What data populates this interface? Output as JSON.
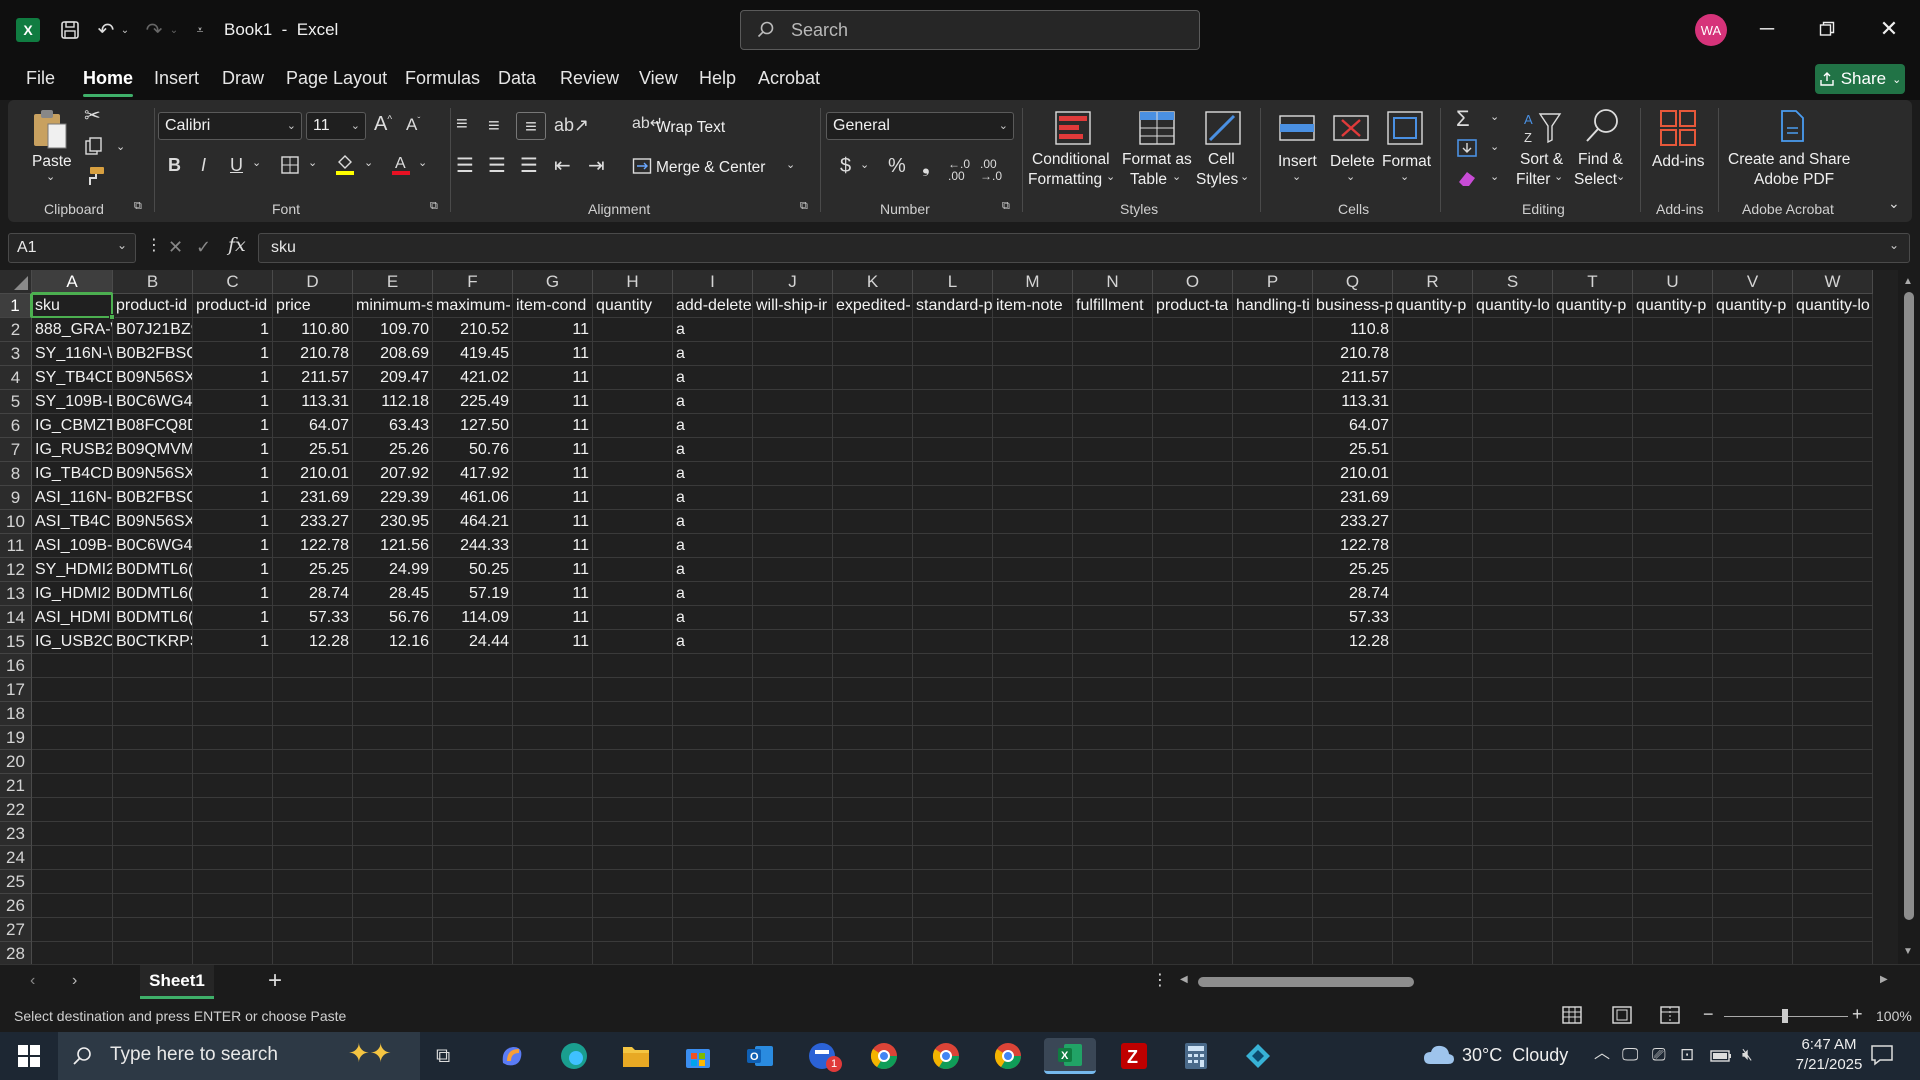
{
  "titlebar": {
    "title": "Book1  -  Excel",
    "search_placeholder": "Search",
    "avatar_initials": "WA"
  },
  "menu": {
    "tabs": [
      "File",
      "Home",
      "Insert",
      "Draw",
      "Page Layout",
      "Formulas",
      "Data",
      "Review",
      "View",
      "Help",
      "Acrobat"
    ],
    "share_label": "Share"
  },
  "ribbon": {
    "clipboard": {
      "paste": "Paste",
      "group": "Clipboard"
    },
    "font": {
      "name": "Calibri",
      "size": "11",
      "group": "Font"
    },
    "alignment": {
      "wrap": "Wrap Text",
      "merge": "Merge & Center",
      "group": "Alignment"
    },
    "number": {
      "format": "General",
      "group": "Number"
    },
    "styles": {
      "conditional_1": "Conditional",
      "conditional_2": "Formatting",
      "table_1": "Format as",
      "table_2": "Table",
      "cell_1": "Cell",
      "cell_2": "Styles",
      "group": "Styles"
    },
    "cells": {
      "insert": "Insert",
      "delete": "Delete",
      "format": "Format",
      "group": "Cells"
    },
    "editing": {
      "sort_1": "Sort &",
      "sort_2": "Filter",
      "find_1": "Find &",
      "find_2": "Select",
      "group": "Editing"
    },
    "addins": {
      "label": "Add-ins",
      "group": "Add-ins"
    },
    "acrobat": {
      "label_1": "Create and Share",
      "label_2": "Adobe PDF",
      "group": "Adobe Acrobat"
    }
  },
  "formula_bar": {
    "name_box": "A1",
    "content": "sku"
  },
  "columns": [
    "A",
    "B",
    "C",
    "D",
    "E",
    "F",
    "G",
    "H",
    "I",
    "J",
    "K",
    "L",
    "M",
    "N",
    "O",
    "P",
    "Q",
    "R",
    "S",
    "T",
    "U",
    "V",
    "W"
  ],
  "header_row": [
    "sku",
    "product-id",
    "product-id",
    "price",
    "minimum-s",
    "maximum-",
    "item-cond",
    "quantity",
    "add-delete",
    "will-ship-ir",
    "expedited-",
    "standard-p",
    "item-note",
    "fulfillment",
    "product-ta",
    "handling-ti",
    "business-p",
    "quantity-p",
    "quantity-lo",
    "quantity-p",
    "quantity-p",
    "quantity-p",
    "quantity-lo"
  ],
  "rows": [
    [
      "888_GRA-\\",
      "B07J21BZ9",
      "1",
      "110.80",
      "109.70",
      "210.52",
      "11",
      "",
      "a",
      "",
      "",
      "",
      "",
      "",
      "",
      "",
      "110.8"
    ],
    [
      "SY_116N-\\",
      "B0B2FBSC.",
      "1",
      "210.78",
      "208.69",
      "419.45",
      "11",
      "",
      "a",
      "",
      "",
      "",
      "",
      "",
      "",
      "",
      "210.78"
    ],
    [
      "SY_TB4CD",
      "B09N56SX",
      "1",
      "211.57",
      "209.47",
      "421.02",
      "11",
      "",
      "a",
      "",
      "",
      "",
      "",
      "",
      "",
      "",
      "211.57"
    ],
    [
      "SY_109B-L",
      "B0C6WG4I",
      "1",
      "113.31",
      "112.18",
      "225.49",
      "11",
      "",
      "a",
      "",
      "",
      "",
      "",
      "",
      "",
      "",
      "113.31"
    ],
    [
      "IG_CBMZT",
      "B08FCQ8D",
      "1",
      "64.07",
      "63.43",
      "127.50",
      "11",
      "",
      "a",
      "",
      "",
      "",
      "",
      "",
      "",
      "",
      "64.07"
    ],
    [
      "IG_RUSB2(",
      "B09QMVM",
      "1",
      "25.51",
      "25.26",
      "50.76",
      "11",
      "",
      "a",
      "",
      "",
      "",
      "",
      "",
      "",
      "",
      "25.51"
    ],
    [
      "IG_TB4CD(",
      "B09N56SX",
      "1",
      "210.01",
      "207.92",
      "417.92",
      "11",
      "",
      "a",
      "",
      "",
      "",
      "",
      "",
      "",
      "",
      "210.01"
    ],
    [
      "ASI_116N-",
      "B0B2FBSC.",
      "1",
      "231.69",
      "229.39",
      "461.06",
      "11",
      "",
      "a",
      "",
      "",
      "",
      "",
      "",
      "",
      "",
      "231.69"
    ],
    [
      "ASI_TB4CI",
      "B09N56SX",
      "1",
      "233.27",
      "230.95",
      "464.21",
      "11",
      "",
      "a",
      "",
      "",
      "",
      "",
      "",
      "",
      "",
      "233.27"
    ],
    [
      "ASI_109B-",
      "B0C6WG4I",
      "1",
      "122.78",
      "121.56",
      "244.33",
      "11",
      "",
      "a",
      "",
      "",
      "",
      "",
      "",
      "",
      "",
      "122.78"
    ],
    [
      "SY_HDMI2",
      "B0DMTL6(",
      "1",
      "25.25",
      "24.99",
      "50.25",
      "11",
      "",
      "a",
      "",
      "",
      "",
      "",
      "",
      "",
      "",
      "25.25"
    ],
    [
      "IG_HDMI2",
      "B0DMTL6(",
      "1",
      "28.74",
      "28.45",
      "57.19",
      "11",
      "",
      "a",
      "",
      "",
      "",
      "",
      "",
      "",
      "",
      "28.74"
    ],
    [
      "ASI_HDMI.",
      "B0DMTL6(",
      "1",
      "57.33",
      "56.76",
      "114.09",
      "11",
      "",
      "a",
      "",
      "",
      "",
      "",
      "",
      "",
      "",
      "57.33"
    ],
    [
      "IG_USB2C(",
      "B0CTKRPS:",
      "1",
      "12.28",
      "12.16",
      "24.44",
      "11",
      "",
      "a",
      "",
      "",
      "",
      "",
      "",
      "",
      "",
      "12.28"
    ]
  ],
  "row_numbers": [
    "1",
    "2",
    "3",
    "4",
    "5",
    "6",
    "7",
    "8",
    "9",
    "10",
    "11",
    "12",
    "13",
    "14",
    "15",
    "16",
    "17",
    "18",
    "19",
    "20",
    "21",
    "22",
    "23",
    "24",
    "25",
    "26",
    "27",
    "28"
  ],
  "sheet": {
    "tab": "Sheet1"
  },
  "status": {
    "message": "Select destination and press ENTER or choose Paste",
    "zoom": "100%"
  },
  "taskbar": {
    "search_placeholder": "Type here to search",
    "weather": "30°C  Cloudy",
    "time": "6:47 AM",
    "date": "7/21/2025",
    "outlook_badge": "1"
  },
  "colors": {
    "accent": "#217346",
    "selection": "#4caf50"
  }
}
